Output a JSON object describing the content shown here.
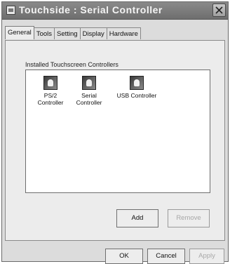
{
  "window": {
    "title": "Touchside : Serial Controller"
  },
  "tabs": [
    {
      "label": "General"
    },
    {
      "label": "Tools"
    },
    {
      "label": "Setting"
    },
    {
      "label": "Display"
    },
    {
      "label": "Hardware"
    }
  ],
  "group": {
    "label": "Installed Touchscreen Controllers"
  },
  "controllers": [
    {
      "label": "PS/2\nController",
      "icon": "hand-touch-icon"
    },
    {
      "label": "Serial\nController",
      "icon": "hand-touch-icon"
    },
    {
      "label": "USB Controller",
      "icon": "hand-touch-icon"
    }
  ],
  "buttons": {
    "add": "Add",
    "remove": "Remove",
    "ok": "OK",
    "cancel": "Cancel",
    "apply": "Apply"
  }
}
